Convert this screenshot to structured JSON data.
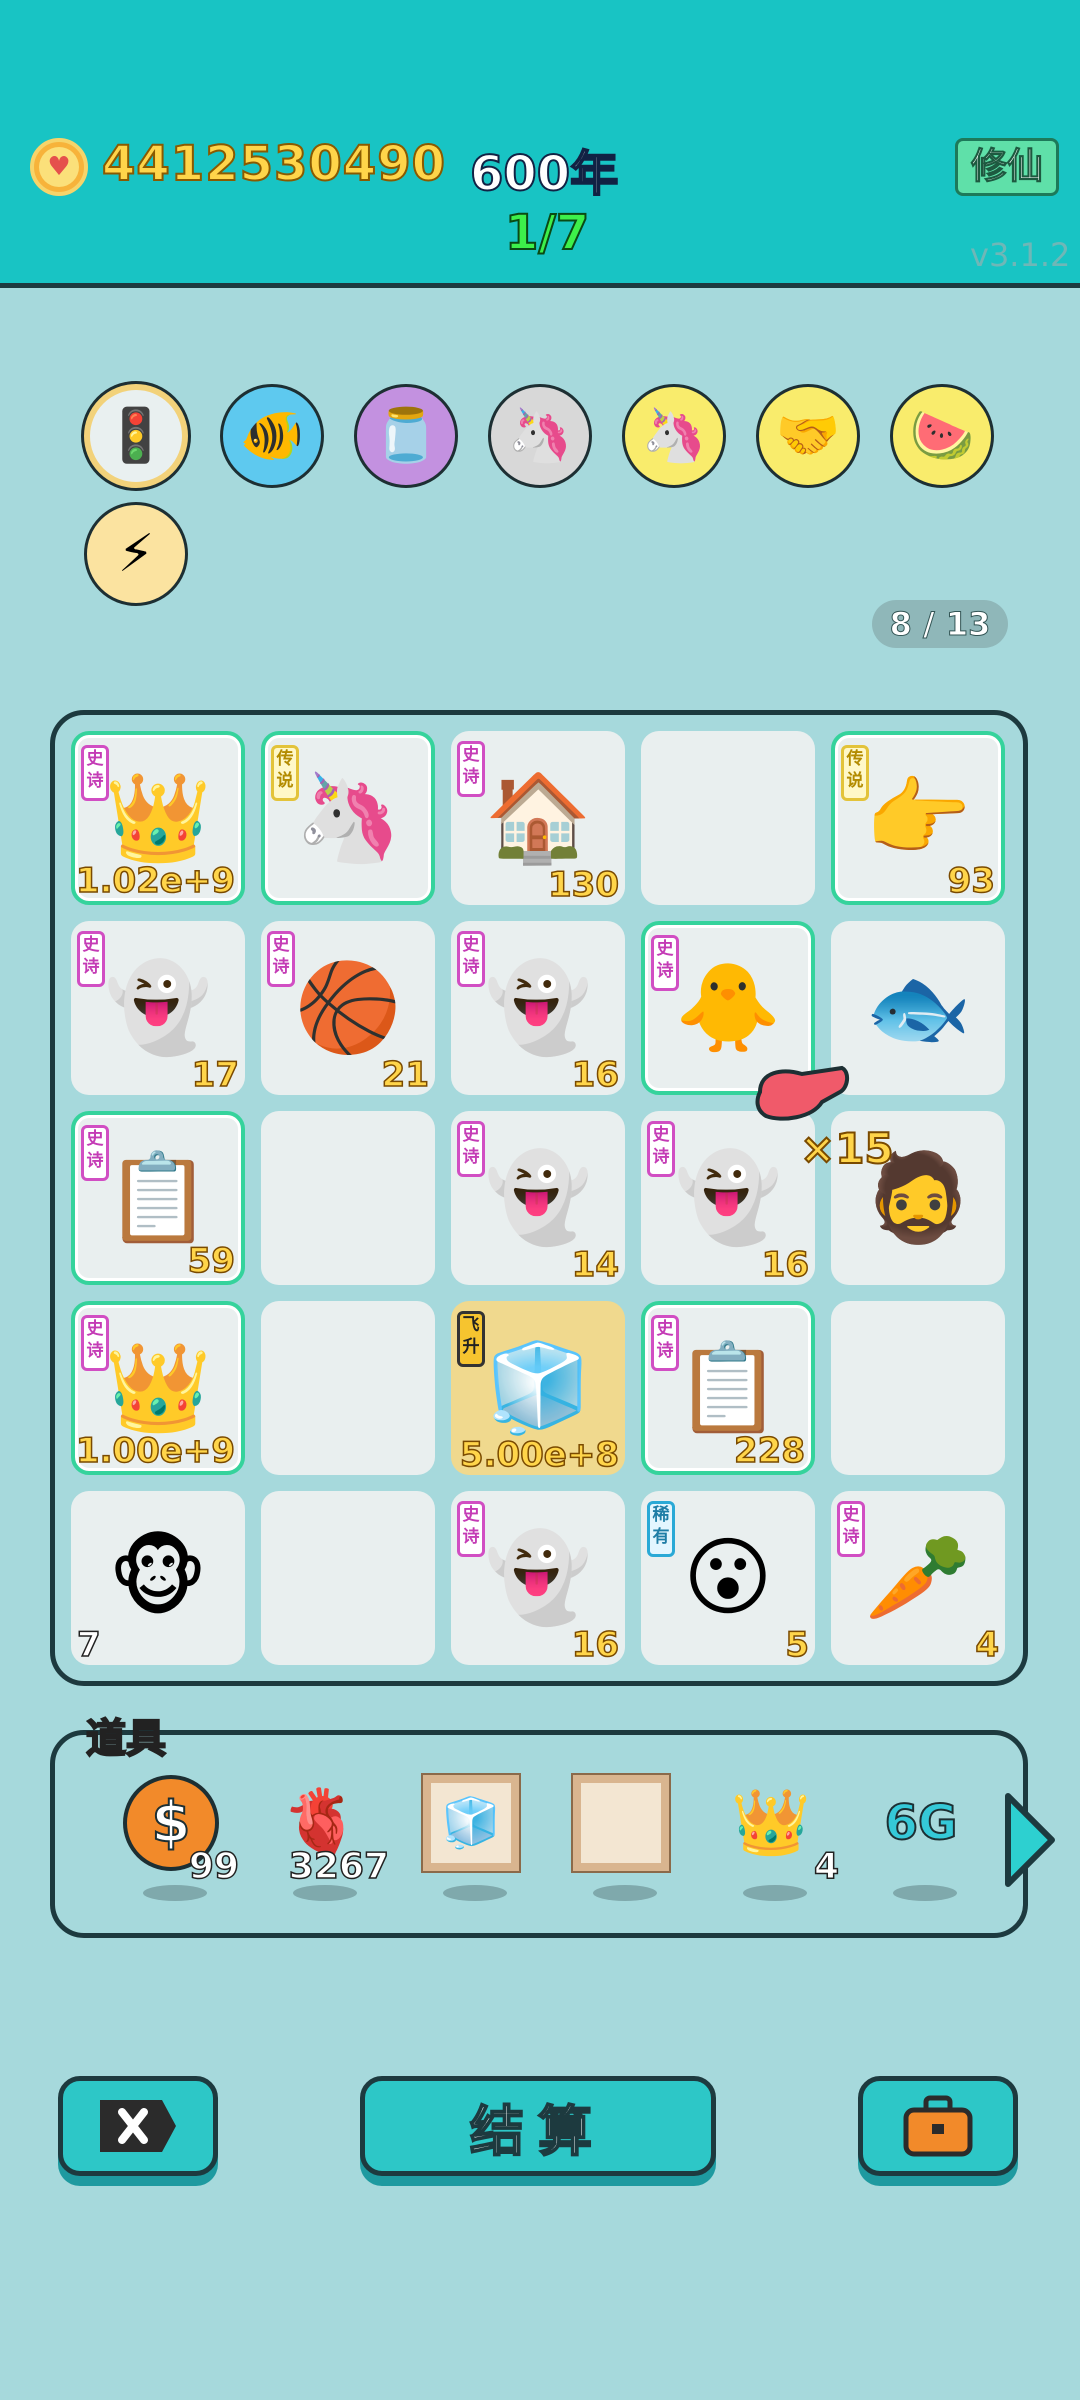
{
  "header": {
    "coins": "4412530490",
    "years": "600年",
    "stage": "1/7",
    "mode_button": "修仙",
    "version": "v3.1.2"
  },
  "skills": [
    {
      "name": "traffic-light-ghost",
      "icon": "🚦"
    },
    {
      "name": "fishbowl",
      "icon": "🐠"
    },
    {
      "name": "jar",
      "icon": "🫙"
    },
    {
      "name": "unicorn-pair",
      "icon": "🦄"
    },
    {
      "name": "unicorn",
      "icon": "🦄"
    },
    {
      "name": "handshake",
      "icon": "🤝"
    },
    {
      "name": "fruit-vip",
      "icon": "🍉"
    },
    {
      "name": "lightning",
      "icon": "⚡"
    }
  ],
  "pager": "8 / 13",
  "board": {
    "cells": [
      {
        "tag": "史诗",
        "tag_type": "epic",
        "icon": "👑",
        "count": "1.02e+9",
        "rare": true
      },
      {
        "tag": "传说",
        "tag_type": "leg",
        "icon": "🦄",
        "count": "",
        "rare": true
      },
      {
        "tag": "史诗",
        "tag_type": "epic",
        "icon": "🏠",
        "count": "130",
        "rare": false
      },
      {
        "tag": "",
        "tag_type": "",
        "icon": "",
        "count": "",
        "rare": false
      },
      {
        "tag": "传说",
        "tag_type": "leg",
        "icon": "👉",
        "count": "93",
        "rare": true
      },
      {
        "tag": "史诗",
        "tag_type": "epic",
        "icon": "👻",
        "count": "17",
        "rare": false
      },
      {
        "tag": "史诗",
        "tag_type": "epic",
        "icon": "🏀",
        "count": "21",
        "rare": false
      },
      {
        "tag": "史诗",
        "tag_type": "epic",
        "icon": "👻",
        "count": "16",
        "rare": false
      },
      {
        "tag": "史诗",
        "tag_type": "epic",
        "icon": "🐥",
        "count": "",
        "rare": true
      },
      {
        "tag": "",
        "tag_type": "",
        "icon": "🐟",
        "count": "",
        "rare": false
      },
      {
        "tag": "史诗",
        "tag_type": "epic",
        "icon": "📋",
        "count": "59",
        "rare": true
      },
      {
        "tag": "",
        "tag_type": "",
        "icon": "",
        "count": "",
        "rare": false
      },
      {
        "tag": "史诗",
        "tag_type": "epic",
        "icon": "👻",
        "count": "14",
        "rare": false
      },
      {
        "tag": "史诗",
        "tag_type": "epic",
        "icon": "👻",
        "count": "16",
        "rare": false
      },
      {
        "tag": "",
        "tag_type": "",
        "icon": "🧔",
        "count": "",
        "rare": false
      },
      {
        "tag": "史诗",
        "tag_type": "epic",
        "icon": "👑",
        "count": "1.00e+9",
        "rare": true
      },
      {
        "tag": "",
        "tag_type": "",
        "icon": "",
        "count": "",
        "rare": false
      },
      {
        "tag": "飞升",
        "tag_type": "fly",
        "icon": "🧊",
        "count": "5.00e+8",
        "rare": false,
        "gold": true
      },
      {
        "tag": "史诗",
        "tag_type": "epic",
        "icon": "📋",
        "count": "228",
        "rare": true
      },
      {
        "tag": "",
        "tag_type": "",
        "icon": "",
        "count": "",
        "rare": false
      },
      {
        "tag": "",
        "tag_type": "",
        "icon": "🐵",
        "count": "7",
        "rare": false,
        "count_left": true
      },
      {
        "tag": "",
        "tag_type": "",
        "icon": "",
        "count": "",
        "rare": false
      },
      {
        "tag": "史诗",
        "tag_type": "epic",
        "icon": "👻",
        "count": "16",
        "rare": false
      },
      {
        "tag": "稀有",
        "tag_type": "rar",
        "icon": "😮",
        "count": "5",
        "rare": false
      },
      {
        "tag": "史诗",
        "tag_type": "epic",
        "icon": "🥕",
        "count": "4",
        "rare": false
      }
    ],
    "floating_multiplier": "×15"
  },
  "items": {
    "label": "道具",
    "list": [
      {
        "name": "coin",
        "icon": "$",
        "count": "99"
      },
      {
        "name": "liver",
        "icon": "🫀",
        "count": "3267"
      },
      {
        "name": "fridge-frame",
        "icon": "🧊",
        "count": ""
      },
      {
        "name": "empty-frame",
        "icon": "",
        "count": ""
      },
      {
        "name": "crown",
        "icon": "👑",
        "count": "4"
      },
      {
        "name": "6g",
        "icon": "6G",
        "count": ""
      }
    ]
  },
  "bottom": {
    "settle_label": "结算"
  }
}
